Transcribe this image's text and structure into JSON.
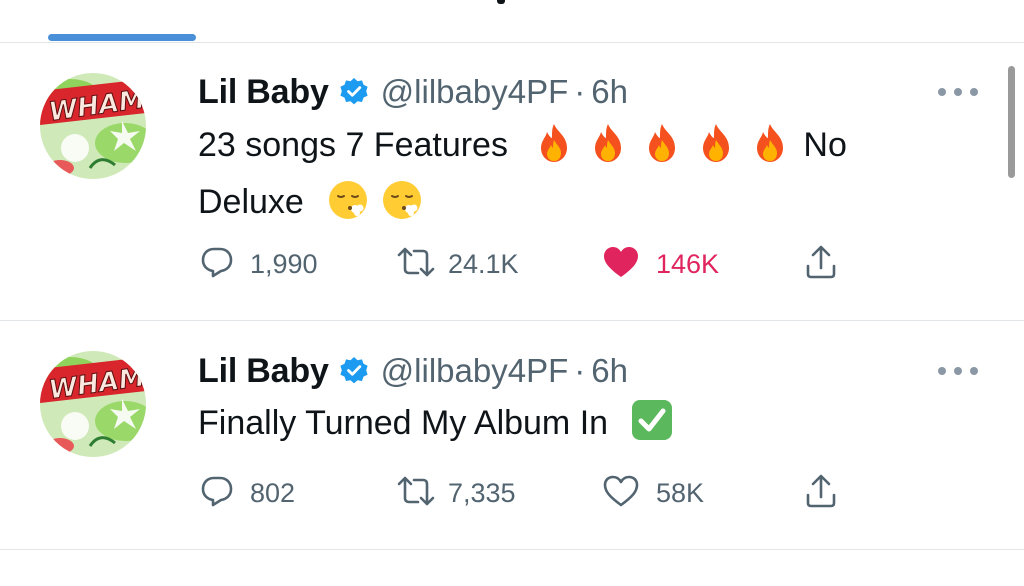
{
  "tabs": {
    "active_index": 0,
    "indicator_color": "#4a90d9"
  },
  "tweets": [
    {
      "author": "Lil Baby",
      "verified": true,
      "handle": "@lilbaby4PF",
      "separator": "·",
      "time": "6h",
      "text_line1_start": "23 songs 7 Features",
      "text_line1_end": "No",
      "text_line2": "Deluxe",
      "emojis": [
        "fire-emoji",
        "fire-emoji",
        "fire-emoji",
        "fire-emoji",
        "fire-emoji",
        "face-exhaling-emoji",
        "face-exhaling-emoji"
      ],
      "replies": "1,990",
      "retweets": "24.1K",
      "likes": "146K",
      "liked": true,
      "like_color": "#e0245e"
    },
    {
      "author": "Lil Baby",
      "verified": true,
      "handle": "@lilbaby4PF",
      "separator": "·",
      "time": "6h",
      "text": "Finally Turned My Album In",
      "emojis": [
        "check-mark-button-emoji"
      ],
      "replies": "802",
      "retweets": "7,335",
      "likes": "58K",
      "liked": false
    }
  ],
  "colors": {
    "text": "#0f1419",
    "secondary": "#536471",
    "verified": "#1d9bf0",
    "divider": "#e1e5e8"
  },
  "icons": [
    "reply-icon",
    "retweet-icon",
    "like-icon",
    "share-icon",
    "more-icon",
    "verified-badge-icon"
  ]
}
